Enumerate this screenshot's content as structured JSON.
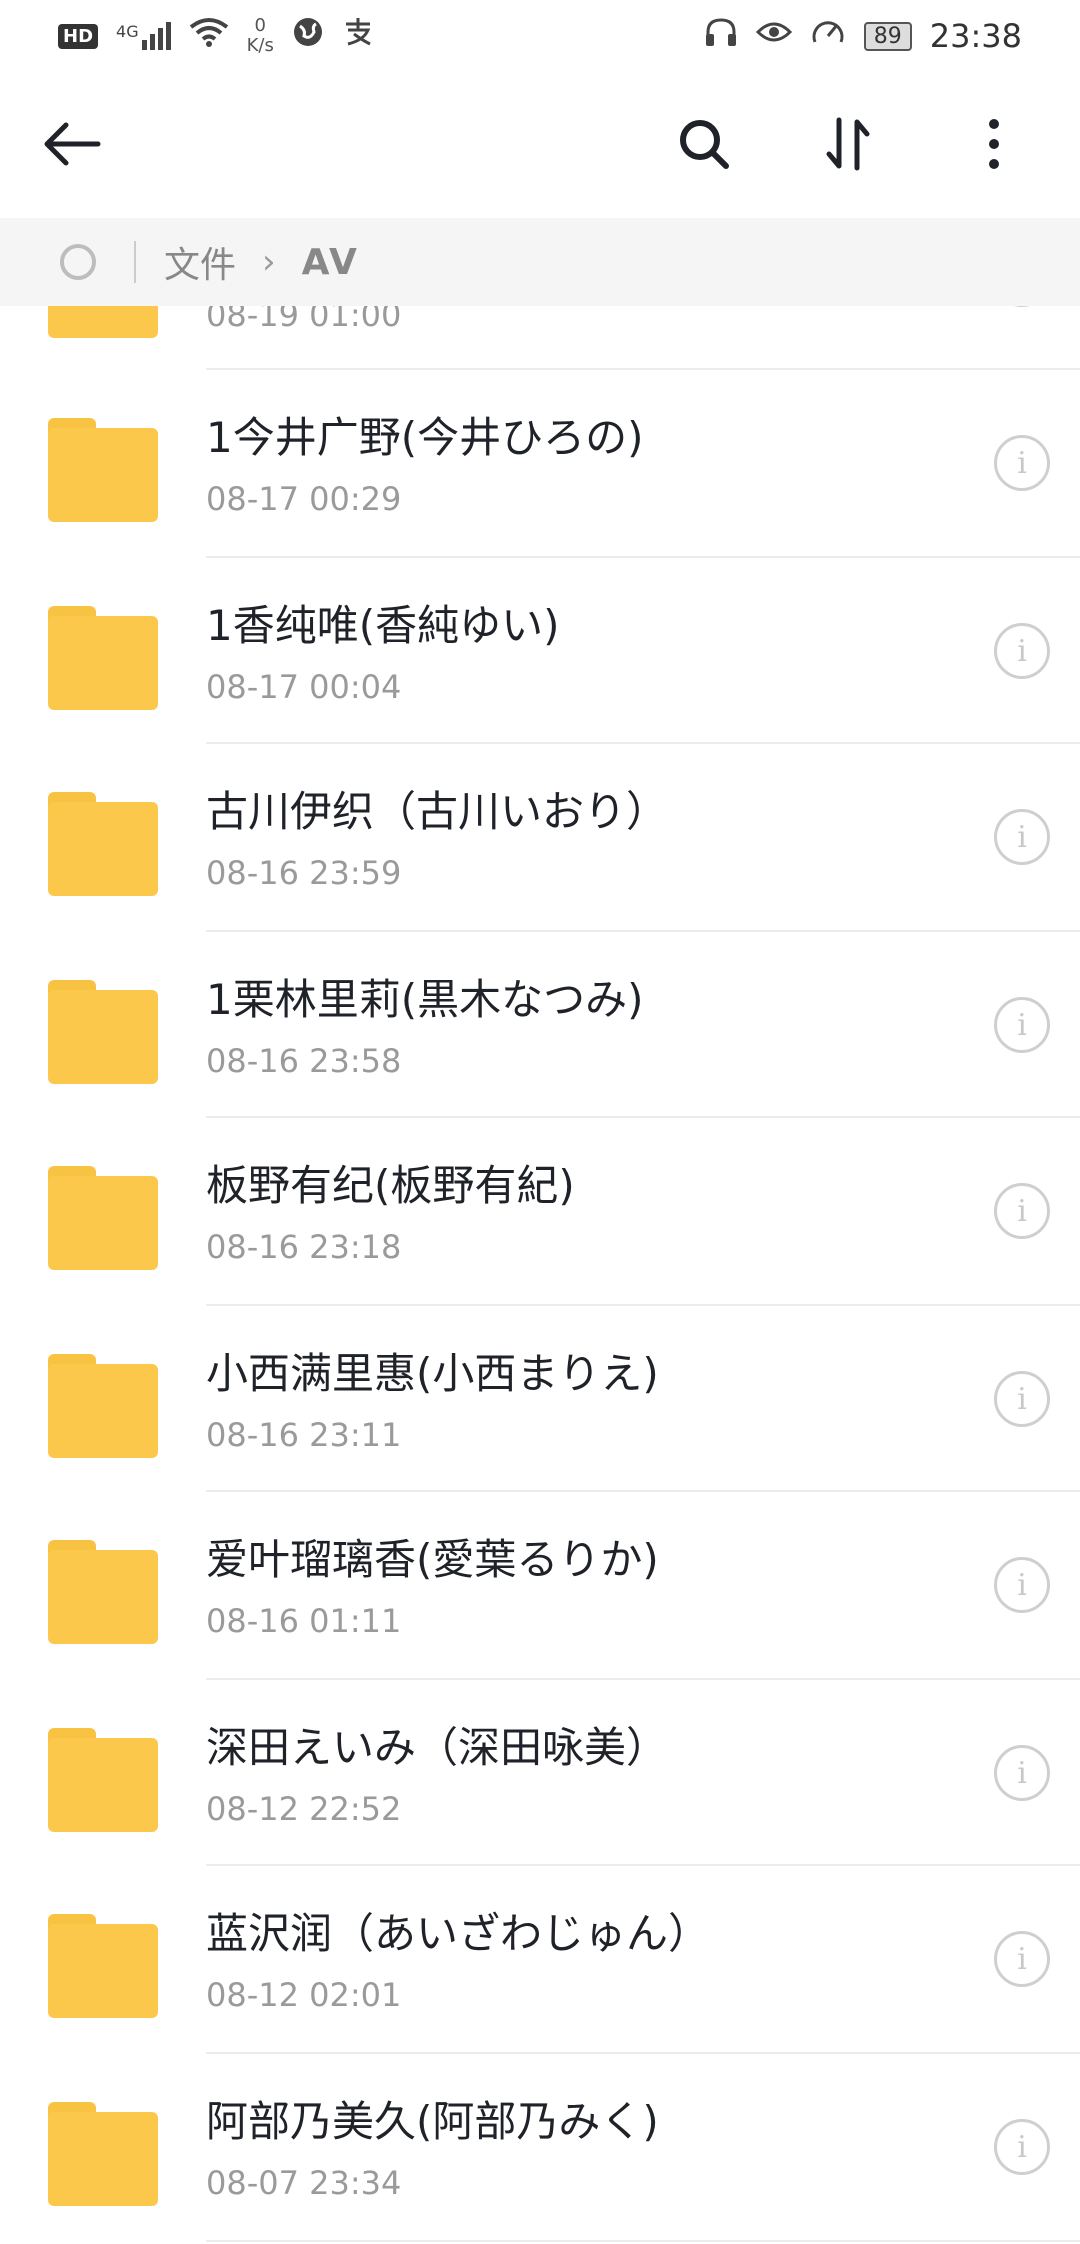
{
  "status_bar": {
    "hd_badge": "HD",
    "network_type": "4G",
    "net_speed_value": "0",
    "net_speed_unit": "K/s",
    "battery": "89",
    "time": "23:38"
  },
  "toolbar": {
    "back_icon": "arrow-left-icon",
    "search_icon": "search-icon",
    "sort_icon": "sort-icon",
    "more_icon": "more-vertical-icon"
  },
  "breadcrumb": {
    "root": "文件",
    "separator": "›",
    "current": "AV"
  },
  "files": [
    {
      "name": "",
      "date": "08-19 01:00"
    },
    {
      "name": "1今井广野(今井ひろの)",
      "date": "08-17 00:29"
    },
    {
      "name": "1香纯唯(香純ゆい)",
      "date": "08-17 00:04"
    },
    {
      "name": "古川伊织（古川いおり）",
      "date": "08-16 23:59"
    },
    {
      "name": "1栗林里莉(黒木なつみ)",
      "date": "08-16 23:58"
    },
    {
      "name": "板野有纪(板野有紀)",
      "date": "08-16 23:18"
    },
    {
      "name": "小西满里惠(小西まりえ)",
      "date": "08-16 23:11"
    },
    {
      "name": "爱叶瑠璃香(愛葉るりか)",
      "date": "08-16 01:11"
    },
    {
      "name": "深田えいみ（深田咏美）",
      "date": "08-12 22:52"
    },
    {
      "name": "蓝沢润（あいざわじゅん）",
      "date": "08-12 02:01"
    },
    {
      "name": "阿部乃美久(阿部乃みく)",
      "date": "08-07 23:34"
    }
  ],
  "info_glyph": "i",
  "colors": {
    "folder": "#fcc84b",
    "breadcrumb_bg": "#f5f5f5",
    "text_primary": "#1f2329",
    "text_secondary": "#9a9a9a"
  }
}
